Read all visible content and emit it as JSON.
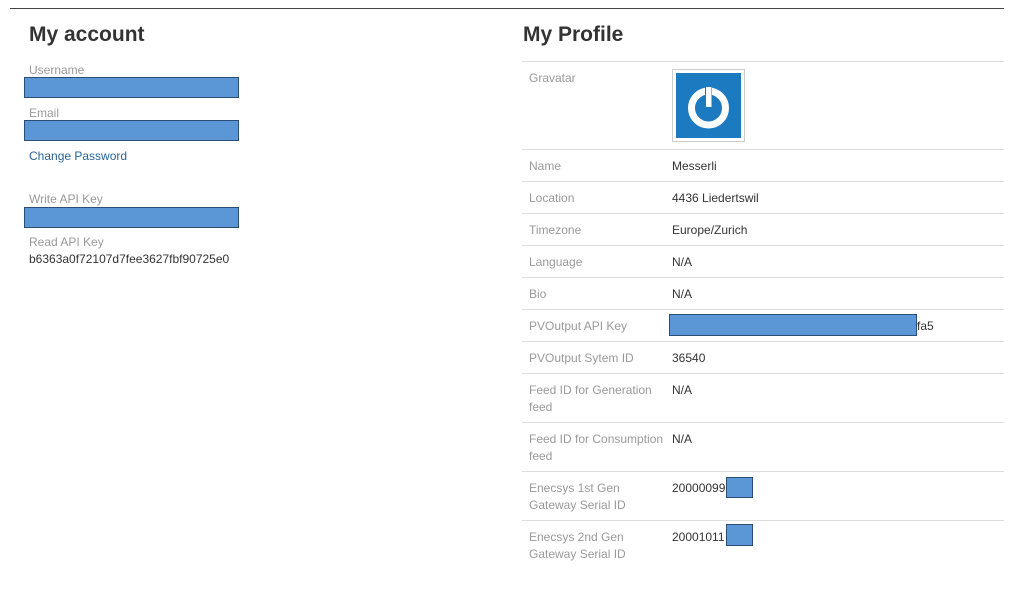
{
  "account": {
    "title": "My account",
    "username_label": "Username",
    "email_label": "Email",
    "change_password": "Change Password",
    "write_api_label": "Write API Key",
    "read_api_label": "Read API Key",
    "read_api_value": "b6363a0f72107d7fee3627fbf90725e0"
  },
  "profile": {
    "title": "My Profile",
    "gravatar_label": "Gravatar",
    "rows": [
      {
        "label": "Name",
        "value": "Messerli"
      },
      {
        "label": "Location",
        "value": "4436 Liedertswil"
      },
      {
        "label": "Timezone",
        "value": "Europe/Zurich"
      },
      {
        "label": "Language",
        "value": "N/A"
      },
      {
        "label": "Bio",
        "value": "N/A"
      },
      {
        "label": "PVOutput API Key",
        "value": "fa5"
      },
      {
        "label": "PVOutput Sytem ID",
        "value": "36540"
      },
      {
        "label": "Feed ID for Generation feed",
        "value": "N/A"
      },
      {
        "label": "Feed ID for Consumption feed",
        "value": "N/A"
      },
      {
        "label": "Enecsys 1st Gen Gateway Serial ID",
        "value": "20000099"
      },
      {
        "label": "Enecsys 2nd Gen Gateway Serial ID",
        "value": "20001011"
      }
    ]
  },
  "colors": {
    "redaction_fill": "#5b97d6",
    "gravatar_blue": "#1c7ac0",
    "link": "#2a6496"
  },
  "icons": {
    "gravatar": "gravatar-power-logo-icon"
  }
}
